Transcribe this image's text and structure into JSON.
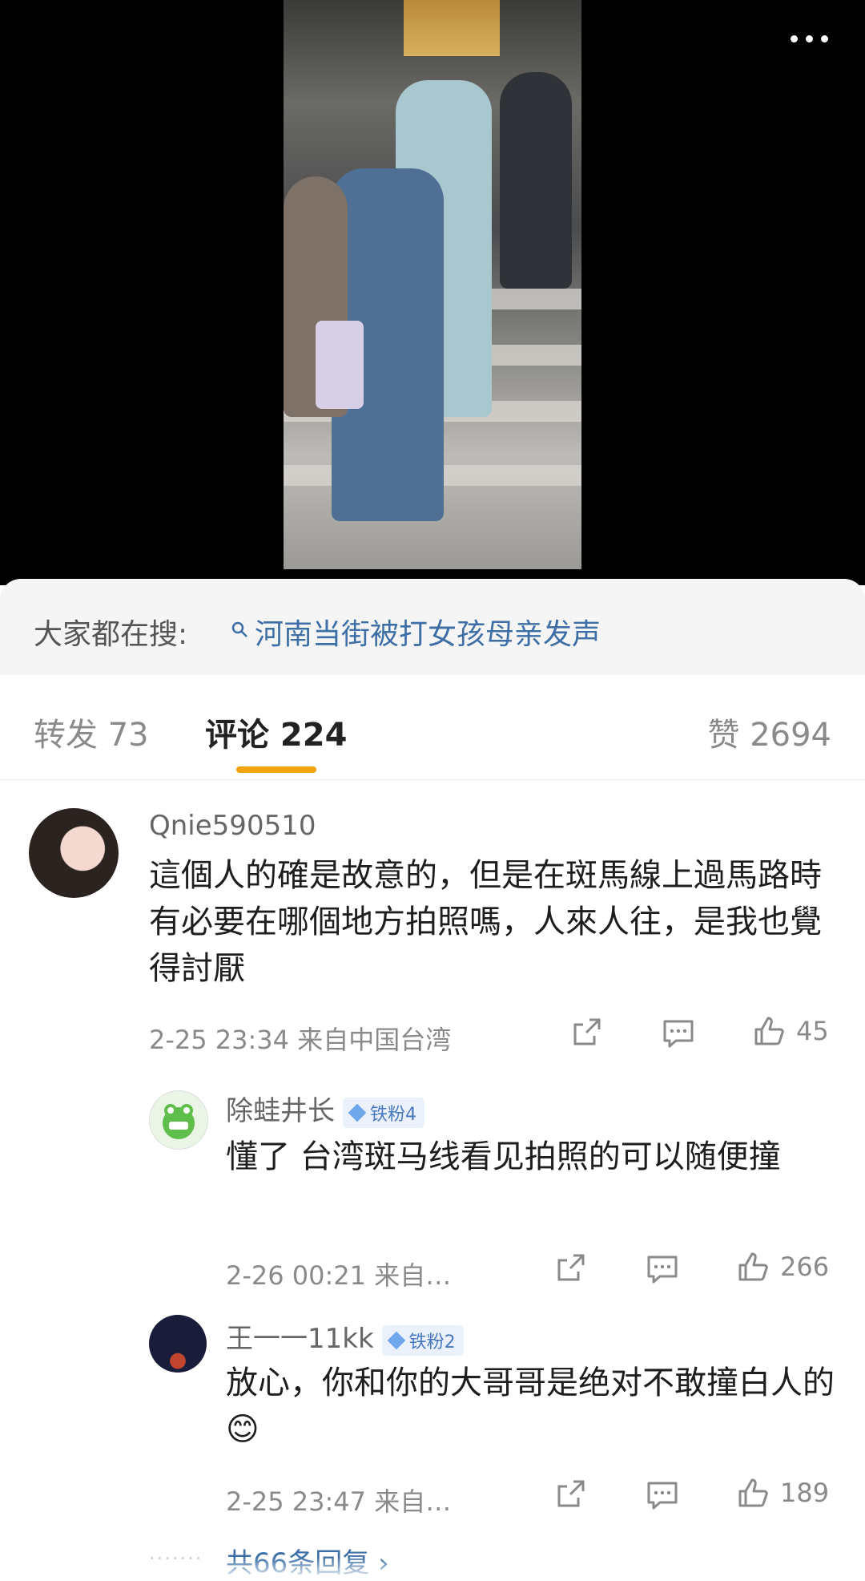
{
  "search": {
    "label": "大家都在搜:",
    "query": "河南当街被打女孩母亲发声"
  },
  "tabs": {
    "forward": "转发 73",
    "comments": "评论 224",
    "likes": "赞 2694",
    "active_color": "#f3a20f"
  },
  "comments": [
    {
      "user": "Qnie590510",
      "text": "這個人的確是故意的，但是在斑馬線上過馬路時有必要在哪個地方拍照嗎，人來人往，是我也覺得討厭",
      "meta": "2-25 23:34 来自中国台湾",
      "likes": "45"
    }
  ],
  "replies": [
    {
      "user": "除蛙井长",
      "badge": "铁粉4",
      "text": "懂了 台湾斑马线看见拍照的可以随便撞",
      "meta": "2-26 00:21 来自…",
      "likes": "266"
    },
    {
      "user": "王一一11kk",
      "badge": "铁粉2",
      "text": "放心，你和你的大哥哥是绝对不敢撞白人的",
      "emoji": "😊",
      "meta": "2-25 23:47 来自…",
      "likes": "189"
    }
  ],
  "view_replies": "共66条回复 ›",
  "icons": [
    "more-icon",
    "search-icon",
    "share-icon",
    "comment-icon",
    "like-icon"
  ]
}
